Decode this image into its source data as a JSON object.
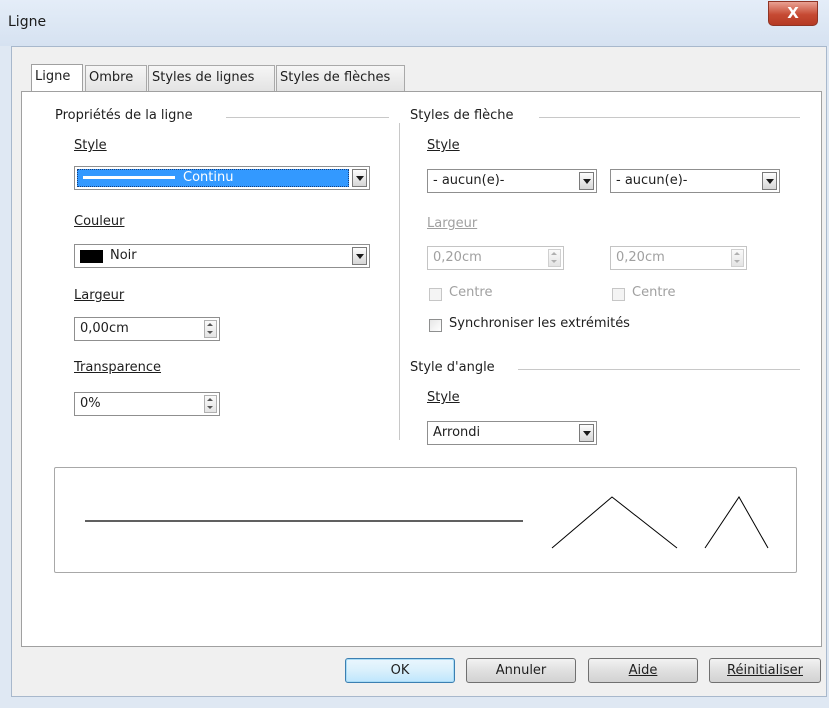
{
  "window": {
    "title": "Ligne",
    "close_glyph": "X"
  },
  "tabs": [
    {
      "label": "Ligne"
    },
    {
      "label": "Ombre"
    },
    {
      "label": "Styles de lignes"
    },
    {
      "label": "Styles de flèches"
    }
  ],
  "line_props": {
    "heading": "Propriétés de la ligne",
    "style_label": "Style",
    "style_value": "Continu",
    "color_label": "Couleur",
    "color_value": "Noir",
    "color_swatch": "#000000",
    "width_label": "Largeur",
    "width_value": "0,00cm",
    "transparency_label": "Transparence",
    "transparency_value": "0%"
  },
  "arrow_styles": {
    "heading": "Styles de flèche",
    "style_label": "Style",
    "start_value": "- aucun(e)-",
    "end_value": "- aucun(e)-",
    "width_label": "Largeur",
    "start_width": "0,20cm",
    "end_width": "0,20cm",
    "center_start_label": "Centre",
    "center_end_label": "Centre",
    "sync_label": "Synchroniser les extrémités"
  },
  "corner_style": {
    "heading": "Style d'angle",
    "style_label": "Style",
    "value": "Arrondi"
  },
  "buttons": {
    "ok": "OK",
    "cancel": "Annuler",
    "help": "Aide",
    "reset": "Réinitialiser"
  },
  "colors": {
    "selection": "#3399ff",
    "title_bar": "#dfe8f3",
    "close_button": "#c64a33"
  }
}
